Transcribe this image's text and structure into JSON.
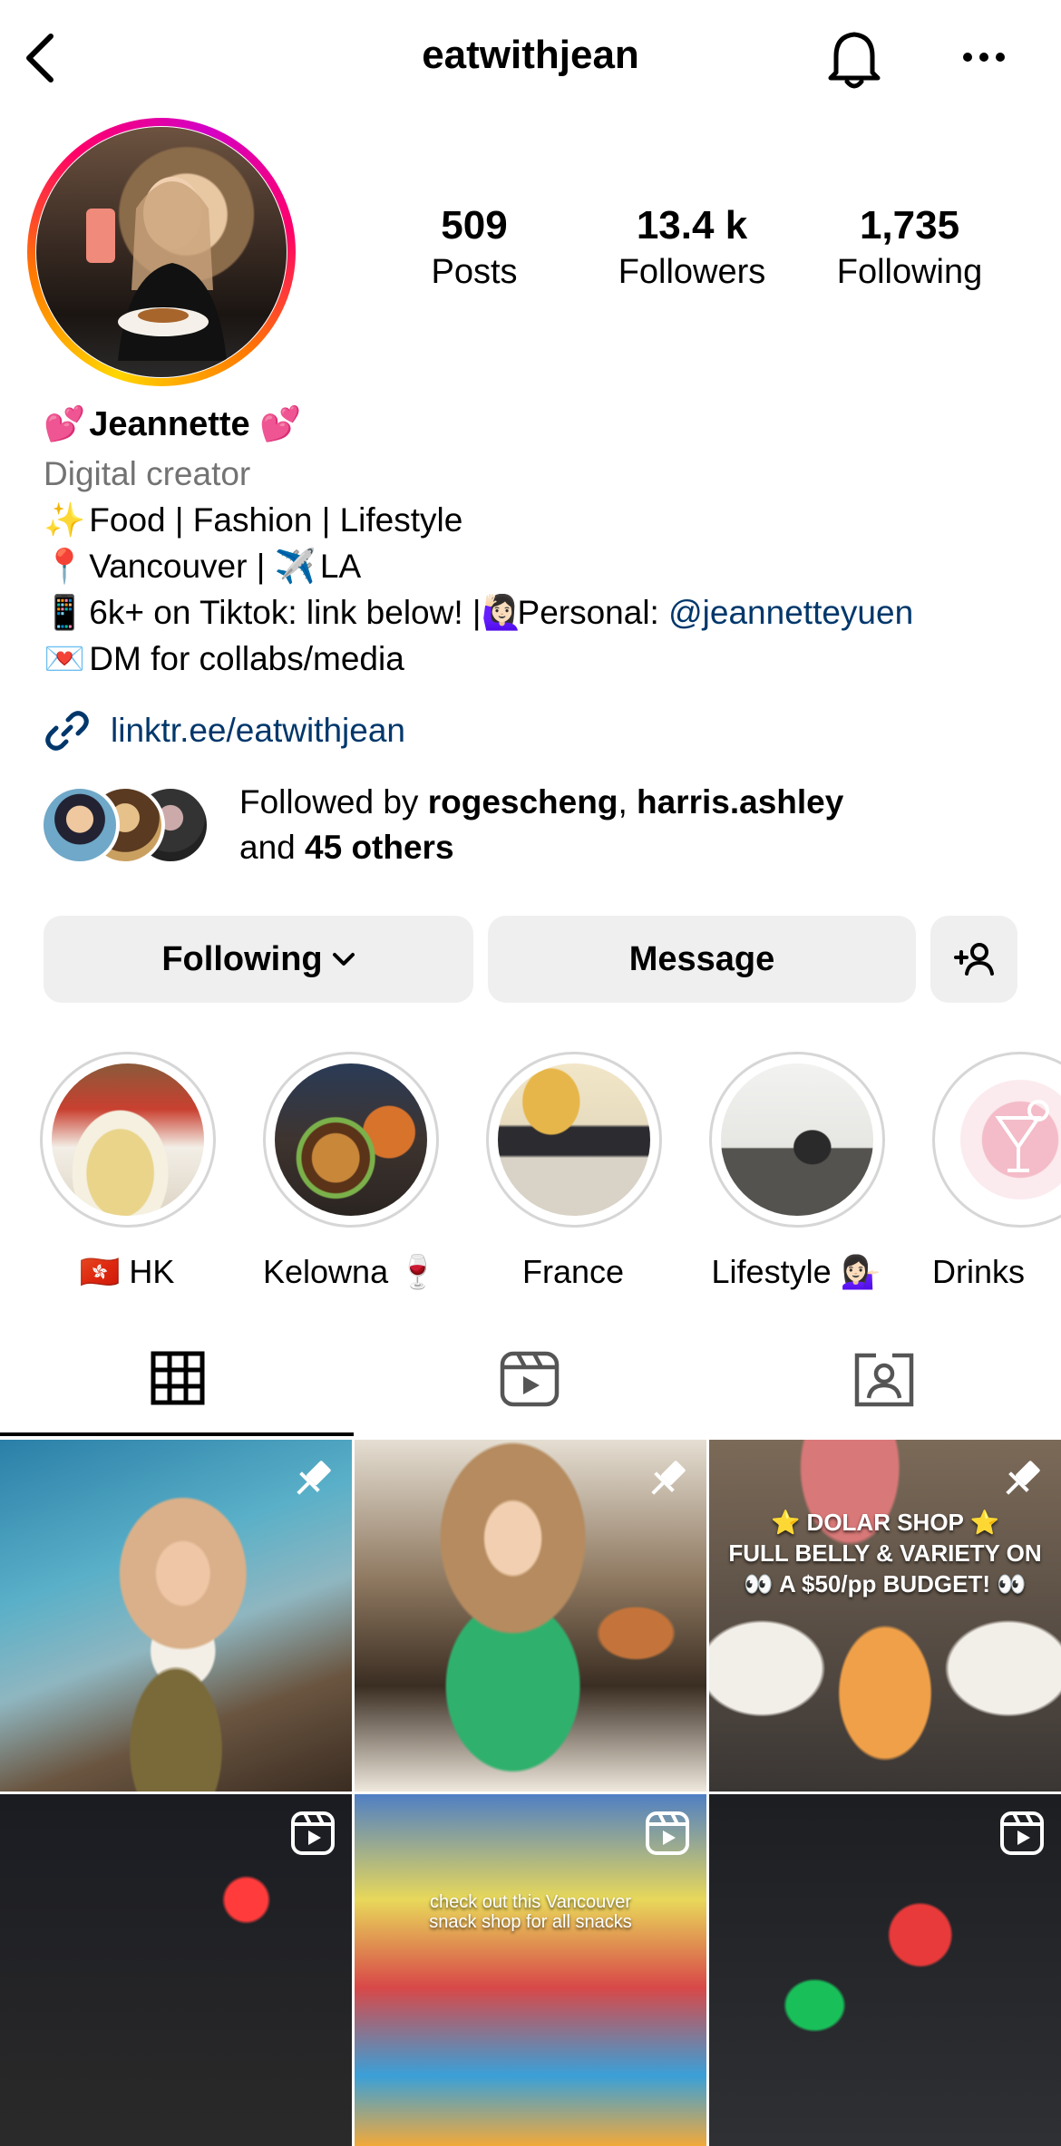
{
  "header": {
    "title": "eatwithjean"
  },
  "stats": [
    {
      "value": "509",
      "label": "Posts"
    },
    {
      "value": "13.4 k",
      "label": "Followers"
    },
    {
      "value": "1,735",
      "label": "Following"
    }
  ],
  "bio": {
    "name": "Jeannette",
    "name_emoji": "💕",
    "category": "Digital creator",
    "line1_emoji": "✨",
    "line1": "Food | Fashion | Lifestyle",
    "line2_emoji": "📍",
    "line2_a": "Vancouver |",
    "line2_emoji2": "✈️",
    "line2_b": "LA",
    "line3_emoji": "📱",
    "line3": "6k+ on Tiktok: link below! |",
    "line3_emoji2": "🙋🏻‍♀️",
    "line3_b": "Personal: ",
    "mention": "@jeannetteyuen",
    "line4_emoji": "💌",
    "line4": "DM for collabs/media"
  },
  "link": {
    "text": "linktr.ee/eatwithjean"
  },
  "followed_by": {
    "prefix": "Followed by ",
    "user1": "rogescheng",
    "sep": ", ",
    "user2": "harris.ashley",
    "and": "and ",
    "others": "45 others"
  },
  "buttons": {
    "following": "Following",
    "message": "Message"
  },
  "highlights": [
    {
      "flag": "🇭🇰",
      "label": "HK"
    },
    {
      "label": "Kelowna",
      "emoji": "🍷"
    },
    {
      "label": "France"
    },
    {
      "label": "Lifestyle",
      "emoji": "💁🏻‍♀️"
    },
    {
      "label": "Drinks"
    }
  ],
  "posts": {
    "post3_text": "⭐ DOLAR SHOP ⭐\nFULL BELLY & VARIETY ON\n👀 A $50/pp BUDGET! 👀",
    "post5_text": "check out this Vancouver\nsnack shop for all snacks"
  },
  "colors": {
    "link": "#00376b",
    "secondary_text": "#737373",
    "button_bg": "#efefef"
  }
}
